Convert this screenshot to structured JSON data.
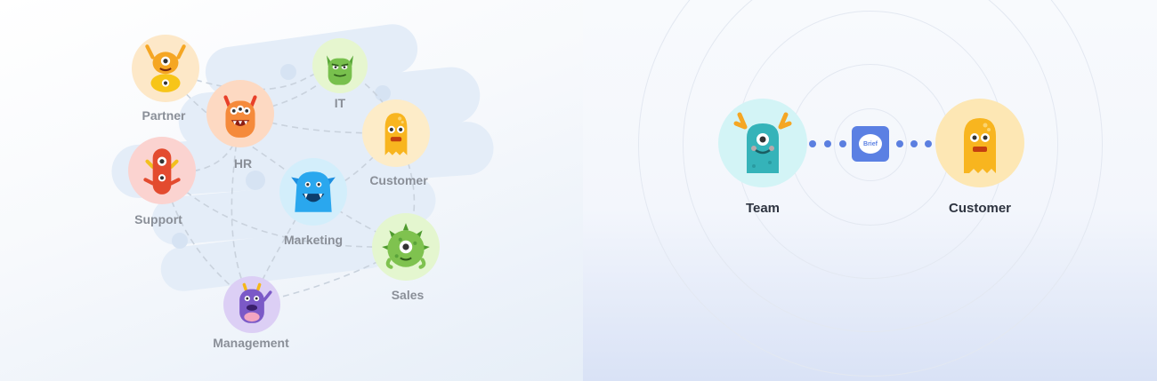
{
  "nodes": [
    {
      "id": "partner",
      "label": "Partner",
      "bg": "#fde8c8",
      "icon": "yellow-stacked-monster-icon"
    },
    {
      "id": "hr",
      "label": "HR",
      "bg": "#fdd9c2",
      "icon": "orange-monster-icon"
    },
    {
      "id": "it",
      "label": "IT",
      "bg": "#e6f6cf",
      "icon": "green-horned-monster-icon"
    },
    {
      "id": "customer",
      "label": "Customer",
      "bg": "#fdecc8",
      "icon": "yellow-blob-monster-icon"
    },
    {
      "id": "support",
      "label": "Support",
      "bg": "#fbd3d0",
      "icon": "red-monster-icon"
    },
    {
      "id": "marketing",
      "label": "Marketing",
      "bg": "#d3eefb",
      "icon": "blue-monster-icon"
    },
    {
      "id": "sales",
      "label": "Sales",
      "bg": "#e4f6cf",
      "icon": "green-spiky-monster-icon"
    },
    {
      "id": "management",
      "label": "Management",
      "bg": "#dccff5",
      "icon": "purple-monster-icon"
    }
  ],
  "flow": {
    "team": {
      "label": "Team",
      "bg": "#d3f4f6",
      "icon": "teal-antler-monster-icon"
    },
    "customer": {
      "label": "Customer",
      "bg": "#fde7b4",
      "icon": "yellow-blob-monster-icon"
    },
    "brief": {
      "label": "Brief",
      "icon": "brief-chat-icon",
      "color": "#5b80e3"
    }
  },
  "colors": {
    "connector": "#5b7fe0",
    "label_gray": "#8a8f98",
    "label_dark": "#2e3440"
  }
}
